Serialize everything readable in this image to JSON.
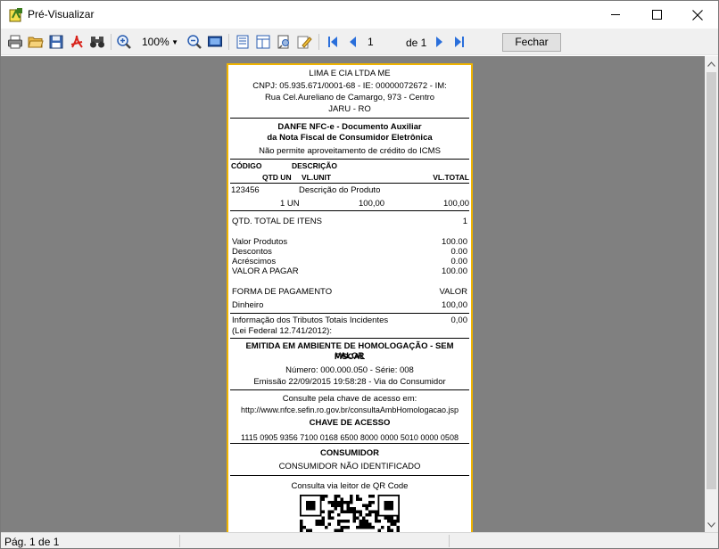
{
  "window": {
    "title": "Pré-Visualizar"
  },
  "toolbar": {
    "zoom": "100%",
    "current_page": "1",
    "page_of": "de 1",
    "close_label": "Fechar"
  },
  "receipt": {
    "company": "LIMA E CIA LTDA ME",
    "cnpj_line": "CNPJ: 05.935.671/0001-68 - IE: 00000072672 - IM:",
    "address": "Rua Cel.Aureliano de Camargo, 973 - Centro",
    "city": "JARU - RO",
    "danfe_title1": "DANFE NFC-e - Documento Auxiliar",
    "danfe_title2": "da Nota Fiscal de Consumidor Eletrônica",
    "icms_note": "Não permite aproveitamento de crédito do ICMS",
    "hdr_codigo": "CÓDIGO",
    "hdr_descricao": "DESCRIÇÃO",
    "hdr_qtd_un": "QTD UN",
    "hdr_vl_unit": "VL.UNIT",
    "hdr_vl_total": "VL.TOTAL",
    "item": {
      "code": "123456",
      "description": "Descrição do Produto",
      "qty_un": "1 UN",
      "unit": "100,00",
      "total": "100,00"
    },
    "qtd_total_label": "QTD. TOTAL DE ITENS",
    "qtd_total_value": "1",
    "valor_produtos_label": "Valor Produtos",
    "valor_produtos_value": "100.00",
    "descontos_label": "Descontos",
    "descontos_value": "0.00",
    "acrescimos_label": "Acréscimos",
    "acrescimos_value": "0.00",
    "valor_pagar_label": "VALOR A PAGAR",
    "valor_pagar_value": "100.00",
    "forma_pag_label": "FORMA DE PAGAMENTO",
    "forma_pag_valor": "VALOR",
    "dinheiro_label": "Dinheiro",
    "dinheiro_value": "100,00",
    "tributos_label": "Informação dos Tributos Totais Incidentes",
    "tributos_value": "0,00",
    "lei_label": "(Lei Federal 12.741/2012):",
    "homolog_line1": "EMITIDA EM AMBIENTE DE HOMOLOGAÇÃO - SEM VALOR",
    "homolog_line2": "FISCAL",
    "numero_serie": "Número: 000.000.050 - Série: 008",
    "emissao": "Emissão 22/09/2015 19:58:28 - Via do Consumidor",
    "consulte": "Consulte pela chave de acesso em:",
    "url": "http://www.nfce.sefin.ro.gov.br/consultaAmbHomologacao.jsp",
    "chave_label": "CHAVE DE ACESSO",
    "chave_value": "1115 0905 9356 7100 0168 6500 8000 0000 5010 0000 0508",
    "consumidor_label": "CONSUMIDOR",
    "consumidor_value": "CONSUMIDOR NÃO IDENTIFICADO",
    "qr_label": "Consulta via leitor de QR Code"
  },
  "status": {
    "page_text": "Pág. 1 de 1"
  },
  "icons": {
    "app": "report-app-icon",
    "print": "printer-icon",
    "open": "folder-open-icon",
    "save": "floppy-disk-icon",
    "pdf": "pdf-icon",
    "find": "binoculars-icon",
    "zoom_in": "zoom-in-icon",
    "zoom_out": "zoom-out-icon",
    "page_setup": "page-setup-icon",
    "first": "first-page-icon",
    "prev": "previous-page-icon",
    "next": "next-page-icon",
    "last": "last-page-icon"
  },
  "colors": {
    "page_border": "#f0b400",
    "preview_bg": "#808080",
    "nav_blue": "#2a6fdb"
  }
}
